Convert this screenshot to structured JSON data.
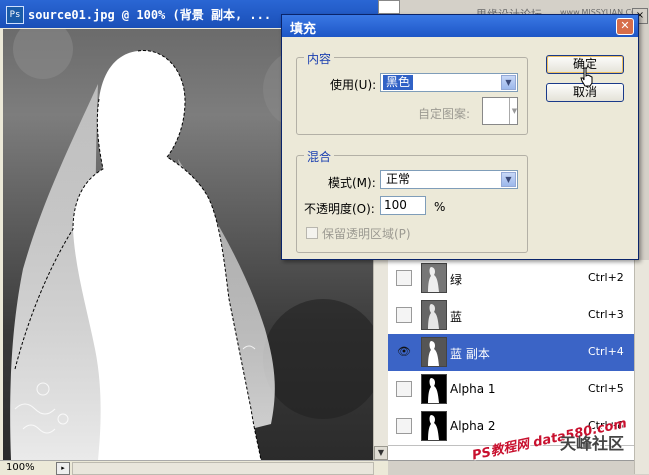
{
  "document": {
    "title": "source01.jpg @ 100% (背景 副本, ...",
    "zoom": "100%",
    "app_icon": "Ps"
  },
  "top_strip": {
    "watermark": "思缘设计论坛",
    "watermark_url": "www.MISSYUAN.COM"
  },
  "fill_dialog": {
    "title": "填充",
    "contents_group": "内容",
    "use_label": "使用(U):",
    "use_value": "黑色",
    "custom_pattern_label": "自定图案:",
    "blending_group": "混合",
    "mode_label": "模式(M):",
    "mode_value": "正常",
    "opacity_label": "不透明度(O):",
    "opacity_value": "100",
    "opacity_unit": "%",
    "preserve_transparency_label": "保留透明区域(P)",
    "ok_label": "确定",
    "cancel_label": "取消"
  },
  "channels": [
    {
      "name": "绿",
      "shortcut": "Ctrl+2",
      "selected": false,
      "visible": false
    },
    {
      "name": "蓝",
      "shortcut": "Ctrl+3",
      "selected": false,
      "visible": false
    },
    {
      "name": "蓝 副本",
      "shortcut": "Ctrl+4",
      "selected": true,
      "visible": true
    },
    {
      "name": "Alpha 1",
      "shortcut": "Ctrl+5",
      "selected": false,
      "visible": false
    },
    {
      "name": "Alpha 2",
      "shortcut": "Ctrl+6",
      "selected": false,
      "visible": false
    }
  ],
  "bottom_watermark": "PS教程网 data580.com",
  "bottom_logo": "天峰社区",
  "colors": {
    "titlebar": "#1d56c6",
    "selected_row": "#3b64c6",
    "dialog_bg": "#ece9d8",
    "group_title": "#1a3fb0"
  }
}
